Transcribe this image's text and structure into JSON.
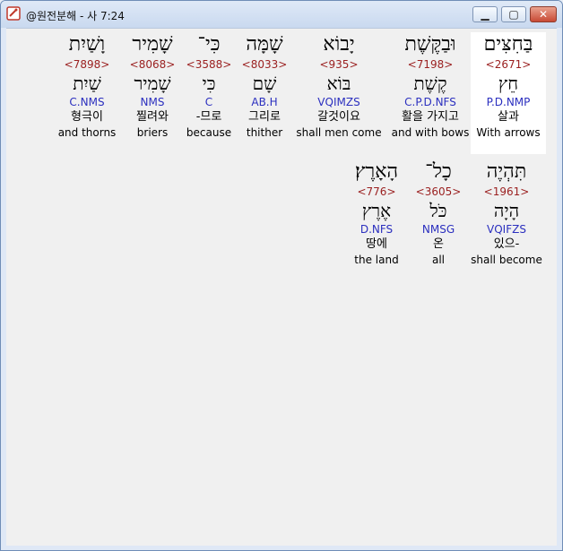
{
  "window": {
    "title": "@원전분해 - 사 7:24"
  },
  "controls": {
    "minimize": "▁",
    "maximize": "▢",
    "close": "✕"
  },
  "rows": [
    [
      {
        "hebrew": "בַּחִצִּים",
        "strong": "<2671>",
        "lemma": "חֵץ",
        "parse": "P.D.NMP",
        "korean": "살과",
        "english": "With arrows",
        "highlight": true
      },
      {
        "hebrew": "וּבַקֶּשֶׁת",
        "strong": "<7198>",
        "lemma": "קֶשֶׁת",
        "parse": "C.P.D.NFS",
        "korean": "활을 가지고",
        "english": "and with bows",
        "highlight": false
      },
      {
        "hebrew": "יָבוֹא",
        "strong": "<935>",
        "lemma": "בּוֹא",
        "parse": "VQIMZS",
        "korean": "갈것이요",
        "english": "shall men come",
        "highlight": false
      },
      {
        "hebrew": "שָׁמָּה",
        "strong": "<8033>",
        "lemma": "שָׁם",
        "parse": "AB.H",
        "korean": "그리로",
        "english": "thither",
        "highlight": false
      },
      {
        "hebrew": "כִּי־",
        "strong": "<3588>",
        "lemma": "כִּי",
        "parse": "C",
        "korean": "-므로",
        "english": "because",
        "highlight": false
      },
      {
        "hebrew": "שָׁמִיר",
        "strong": "<8068>",
        "lemma": "שָׁמִיר",
        "parse": "NMS",
        "korean": "찔려와",
        "english": "briers",
        "highlight": false
      },
      {
        "hebrew": "וָשַׁיִת",
        "strong": "<7898>",
        "lemma": "שַׁיִת",
        "parse": "C.NMS",
        "korean": "형극이",
        "english": "and thorns",
        "highlight": false
      }
    ],
    [
      {
        "hebrew": "תִּהְיֶה",
        "strong": "<1961>",
        "lemma": "הָיָה",
        "parse": "VQIFZS",
        "korean": "있으-",
        "english": "shall become",
        "highlight": false
      },
      {
        "hebrew": "כָל־",
        "strong": "<3605>",
        "lemma": "כֹּל",
        "parse": "NMSG",
        "korean": "온",
        "english": "all",
        "highlight": false
      },
      {
        "hebrew": "הָאָרֶץ׃",
        "strong": "<776>",
        "lemma": "אֶרֶץ",
        "parse": "D.NFS",
        "korean": "땅에",
        "english": "the land",
        "highlight": false
      }
    ]
  ]
}
